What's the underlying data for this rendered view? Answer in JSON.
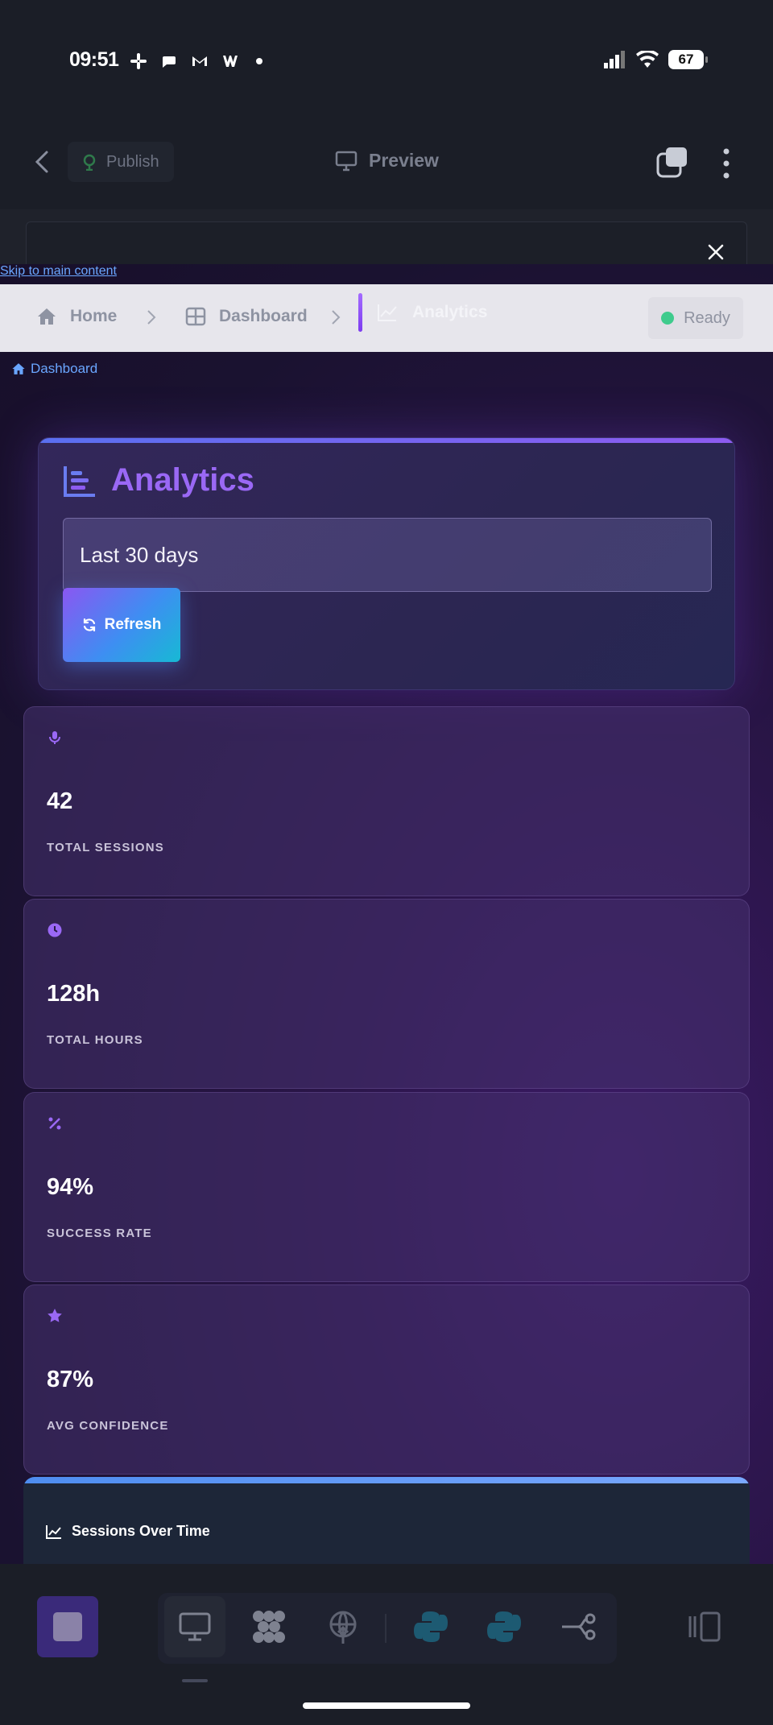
{
  "status_bar": {
    "time": "09:51",
    "battery": "67"
  },
  "app_toolbar": {
    "publish_label": "Publish",
    "preview_label": "Preview"
  },
  "skip_link": "Skip to main content",
  "breadcrumb": {
    "items": [
      {
        "label": "Home",
        "icon": "home-icon"
      },
      {
        "label": "Dashboard",
        "icon": "grid-icon"
      },
      {
        "label": "Analytics",
        "icon": "chart-line-icon"
      }
    ],
    "status": "Ready"
  },
  "dashboard_link": "Dashboard",
  "hero": {
    "title": "Analytics",
    "range_value": "Last 30 days",
    "refresh_label": "Refresh"
  },
  "stats": [
    {
      "value": "42",
      "label": "TOTAL SESSIONS",
      "icon": "microphone-icon"
    },
    {
      "value": "128h",
      "label": "TOTAL HOURS",
      "icon": "clock-icon"
    },
    {
      "value": "94%",
      "label": "SUCCESS RATE",
      "icon": "percent-icon"
    },
    {
      "value": "87%",
      "label": "AVG CONFIDENCE",
      "icon": "star-icon"
    }
  ],
  "chart_card": {
    "title": "Sessions Over Time"
  },
  "colors": {
    "accent": "#9a68f5",
    "ready": "#3fcb8d",
    "link": "#6aa6ff"
  }
}
